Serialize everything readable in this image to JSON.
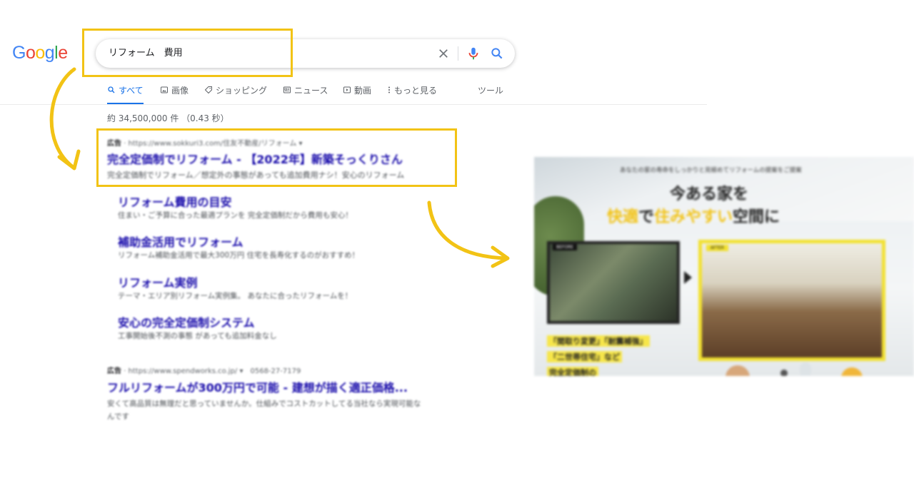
{
  "logo": {
    "letters": [
      "G",
      "o",
      "o",
      "g",
      "l",
      "e"
    ],
    "colors": [
      "#4285F4",
      "#EA4335",
      "#FBBC05",
      "#4285F4",
      "#34A853",
      "#EA4335"
    ]
  },
  "search": {
    "value": "リフォーム　費用"
  },
  "tabs": {
    "all": "すべて",
    "images": "画像",
    "shopping": "ショッピング",
    "news": "ニュース",
    "videos": "動画",
    "more": "もっと見る",
    "tools": "ツール"
  },
  "result_stats": "約 34,500,000 件 （0.43 秒）",
  "ads": [
    {
      "label": "広告",
      "url": "· https://www.sokkuri3.com/住友不動産/リフォーム ▾",
      "title": "完全定価制でリフォーム - 【2022年】新築そっくりさん",
      "desc": "完全定価制でリフォーム／想定外の事態があっても追加費用ナシ！安心のリフォーム",
      "sitelinks": [
        {
          "title": "リフォーム費用の目安",
          "desc": "住まい・ご予算に合った最適プランを 完全定価制だから費用も安心！"
        },
        {
          "title": "補助金活用でリフォーム",
          "desc": "リフォーム補助金活用で最大300万円 住宅を長寿化するのがおすすめ！"
        },
        {
          "title": "リフォーム実例",
          "desc": "テーマ・エリア別リフォーム実例集。 あなたに合ったリフォームを！"
        },
        {
          "title": "安心の完全定価制システム",
          "desc": "工事開始後不測の事態 があっても追加料金なし"
        }
      ]
    },
    {
      "label": "広告",
      "url": "· https://www.spendworks.co.jp/ ▾　0568-27-7179",
      "title": "フルリフォームが300万円で可能 - 建想が描く適正価格...",
      "desc_line1": "安くて高品質は無理だと思っていませんか。仕組みでコストカットしてる当社なら実現可能な",
      "desc_line2": "んです"
    }
  ],
  "banner": {
    "subtitle": "あなたの家の寿命をしっかりと見極めてリフォームの提案をご提案",
    "headline_1": "今ある家を",
    "headline_2_part1": "快適",
    "headline_2_part2": "で",
    "headline_2_part3": "住みやすい",
    "headline_2_part4": "空間に",
    "before_label": "BEFORE",
    "after_label": "AFTER",
    "tag_1": "「間取り変更」「耐震補強」",
    "tag_2": "「二世帯住宅」など",
    "tag_3": "完全定価制の",
    "accent_color": "#f2c315"
  },
  "highlight_color": "#f2c315"
}
